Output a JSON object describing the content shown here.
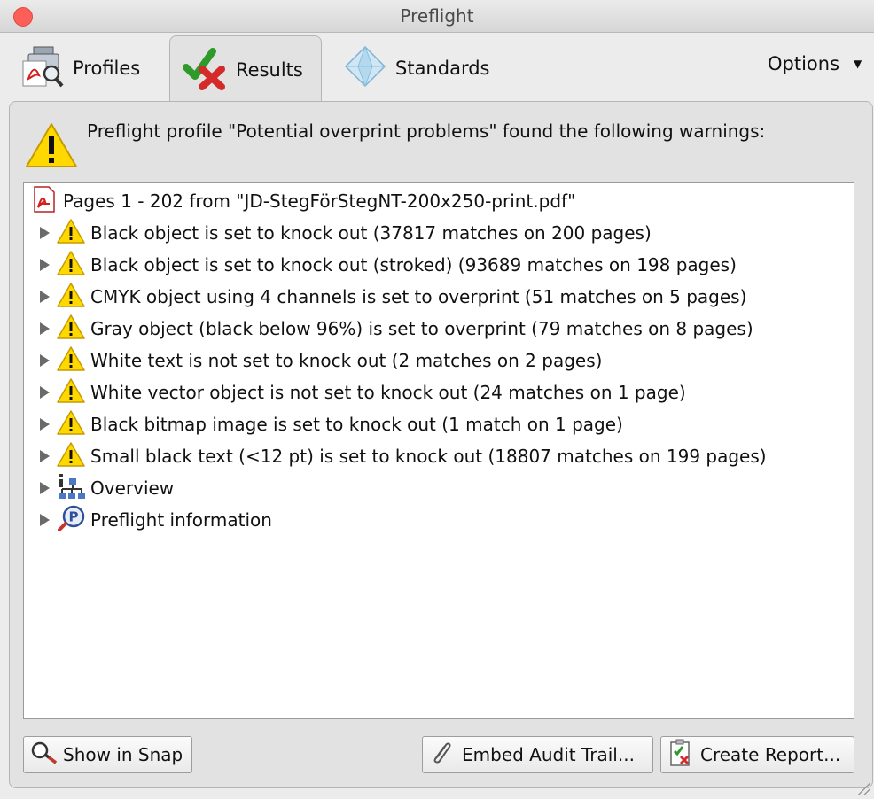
{
  "window": {
    "title": "Preflight"
  },
  "tabs": [
    {
      "label": "Profiles",
      "icon": "profile-icon"
    },
    {
      "label": "Results",
      "icon": "check-cross-icon",
      "active": true
    },
    {
      "label": "Standards",
      "icon": "diamond-icon"
    }
  ],
  "options_label": "Options",
  "message": "Preflight profile \"Potential overprint problems\" found the following warnings:",
  "tree": {
    "root": "Pages 1 - 202 from \"JD-StegFörStegNT-200x250-print.pdf\"",
    "items": [
      {
        "label": "Black object is set to knock out (37817 matches on 200 pages)",
        "icon": "warning-icon"
      },
      {
        "label": "Black object is set to knock out (stroked) (93689 matches on 198 pages)",
        "icon": "warning-icon"
      },
      {
        "label": "CMYK object using 4 channels is set to overprint (51 matches on 5 pages)",
        "icon": "warning-icon"
      },
      {
        "label": "Gray object (black below 96%) is set to overprint (79 matches on 8 pages)",
        "icon": "warning-icon"
      },
      {
        "label": "White text is not set to knock out (2 matches on 2 pages)",
        "icon": "warning-icon"
      },
      {
        "label": "White vector object is not set to knock out (24 matches on 1 page)",
        "icon": "warning-icon"
      },
      {
        "label": "Black bitmap image is set to knock out (1 match on 1 page)",
        "icon": "warning-icon"
      },
      {
        "label": "Small black text (<12 pt) is set to knock out (18807 matches on 199 pages)",
        "icon": "warning-icon"
      },
      {
        "label": "Overview",
        "icon": "hierarchy-icon"
      },
      {
        "label": "Preflight information",
        "icon": "preflight-info-icon"
      }
    ]
  },
  "buttons": {
    "show_in_snap": "Show in Snap",
    "embed_audit_trail": "Embed Audit Trail...",
    "create_report": "Create Report..."
  }
}
